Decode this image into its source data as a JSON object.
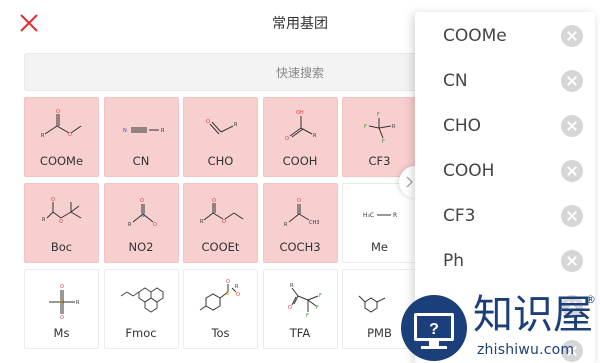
{
  "header": {
    "title": "常用基团"
  },
  "search": {
    "placeholder": "快速搜索"
  },
  "grid": {
    "rows": [
      [
        {
          "label": "COOMe",
          "selected": true
        },
        {
          "label": "CN",
          "selected": true
        },
        {
          "label": "CHO",
          "selected": true
        },
        {
          "label": "COOH",
          "selected": true
        },
        {
          "label": "CF3",
          "selected": true
        }
      ],
      [
        {
          "label": "Boc",
          "selected": true
        },
        {
          "label": "NO2",
          "selected": true
        },
        {
          "label": "COOEt",
          "selected": true
        },
        {
          "label": "COCH3",
          "selected": true
        },
        {
          "label": "Me",
          "selected": false
        }
      ],
      [
        {
          "label": "Ms",
          "selected": false
        },
        {
          "label": "Fmoc",
          "selected": false
        },
        {
          "label": "Tos",
          "selected": false
        },
        {
          "label": "TFA",
          "selected": false
        },
        {
          "label": "PMB",
          "selected": false
        }
      ]
    ]
  },
  "selected_panel": {
    "items": [
      "COOMe",
      "CN",
      "CHO",
      "COOH",
      "CF3",
      "Ph"
    ]
  },
  "watermark": {
    "cn": "知识屋",
    "en": "zhishiwu.com",
    "reg": "®"
  },
  "colors": {
    "accent": "#e0302e",
    "selected_bg": "#f8cfcf",
    "watermark": "#1b3f7a"
  }
}
